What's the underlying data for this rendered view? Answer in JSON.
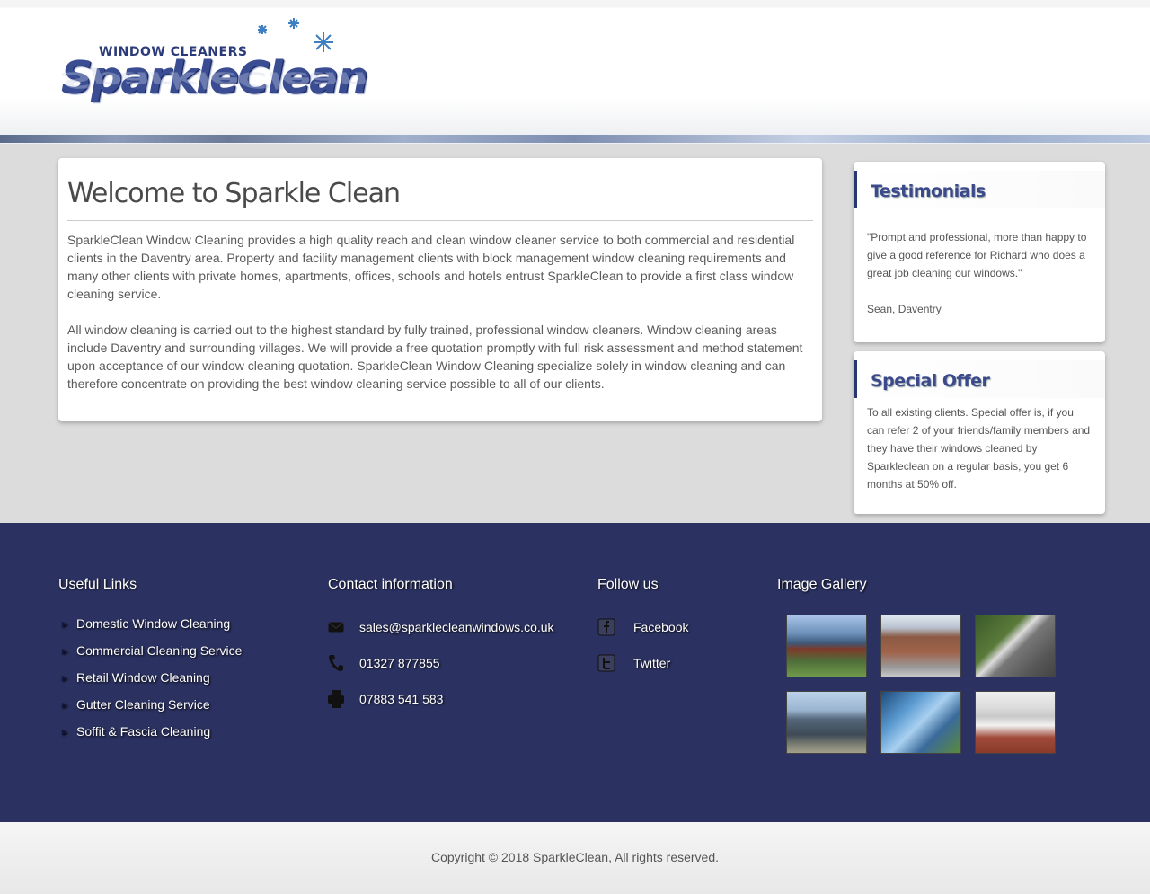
{
  "header": {
    "logo_tagline": "WINDOW CLEANERS",
    "logo_brand": "SparkleClean"
  },
  "main": {
    "title": "Welcome to Sparkle Clean",
    "paragraphs": [
      "SparkleClean Window Cleaning provides a high quality reach and clean window cleaner service to both commercial and residential clients in the Daventry area. Property and facility management clients with block management window cleaning requirements and many other clients with private homes, apartments, offices, schools and hotels entrust SparkleClean to provide a first class window cleaning service.",
      "All window cleaning is carried out to the highest standard by fully trained, professional  window cleaners. Window cleaning areas include Daventry and surrounding villages. We will provide a free quotation promptly with full risk assessment and method statement upon acceptance of our window cleaning quotation. SparkleClean Window Cleaning specialize solely in window cleaning and can therefore concentrate on providing the best window cleaning service possible to all of our clients."
    ]
  },
  "sidebar": {
    "testimonials": {
      "title": "Testimonials",
      "quote": "\"Prompt and professional, more than happy to give a good reference for Richard who does a great job cleaning our windows.\"",
      "author": "Sean, Daventry"
    },
    "special_offer": {
      "title": "Special Offer",
      "text": "To all existing clients. Special offer is, if you can refer 2 of your friends/family members and they have their windows cleaned by Sparkleclean on a regular basis, you get 6 months at 50% off."
    }
  },
  "footer": {
    "useful_links": {
      "title": "Useful Links",
      "items": [
        "Domestic Window Cleaning",
        "Commercial Cleaning Service",
        "Retail Window Cleaning",
        "Gutter Cleaning Service",
        "Soffit & Fascia Cleaning"
      ]
    },
    "contact": {
      "title": "Contact information",
      "email": "sales@sparklecleanwindows.co.uk",
      "phone": "01327 877855",
      "fax": "07883 541 583"
    },
    "follow": {
      "title": "Follow us",
      "facebook": "Facebook",
      "twitter": "Twitter"
    },
    "gallery": {
      "title": "Image Gallery"
    }
  },
  "copyright": "Copyright © 2018 SparkleClean, All rights reserved.",
  "colors": {
    "footer_bg": "#2b3160",
    "brand_blue": "#3a4d93",
    "accent_border": "#2a3570"
  },
  "icons": [
    "envelope-icon",
    "phone-icon",
    "fax-icon",
    "facebook-icon",
    "twitter-icon",
    "chevron-right-icon"
  ]
}
